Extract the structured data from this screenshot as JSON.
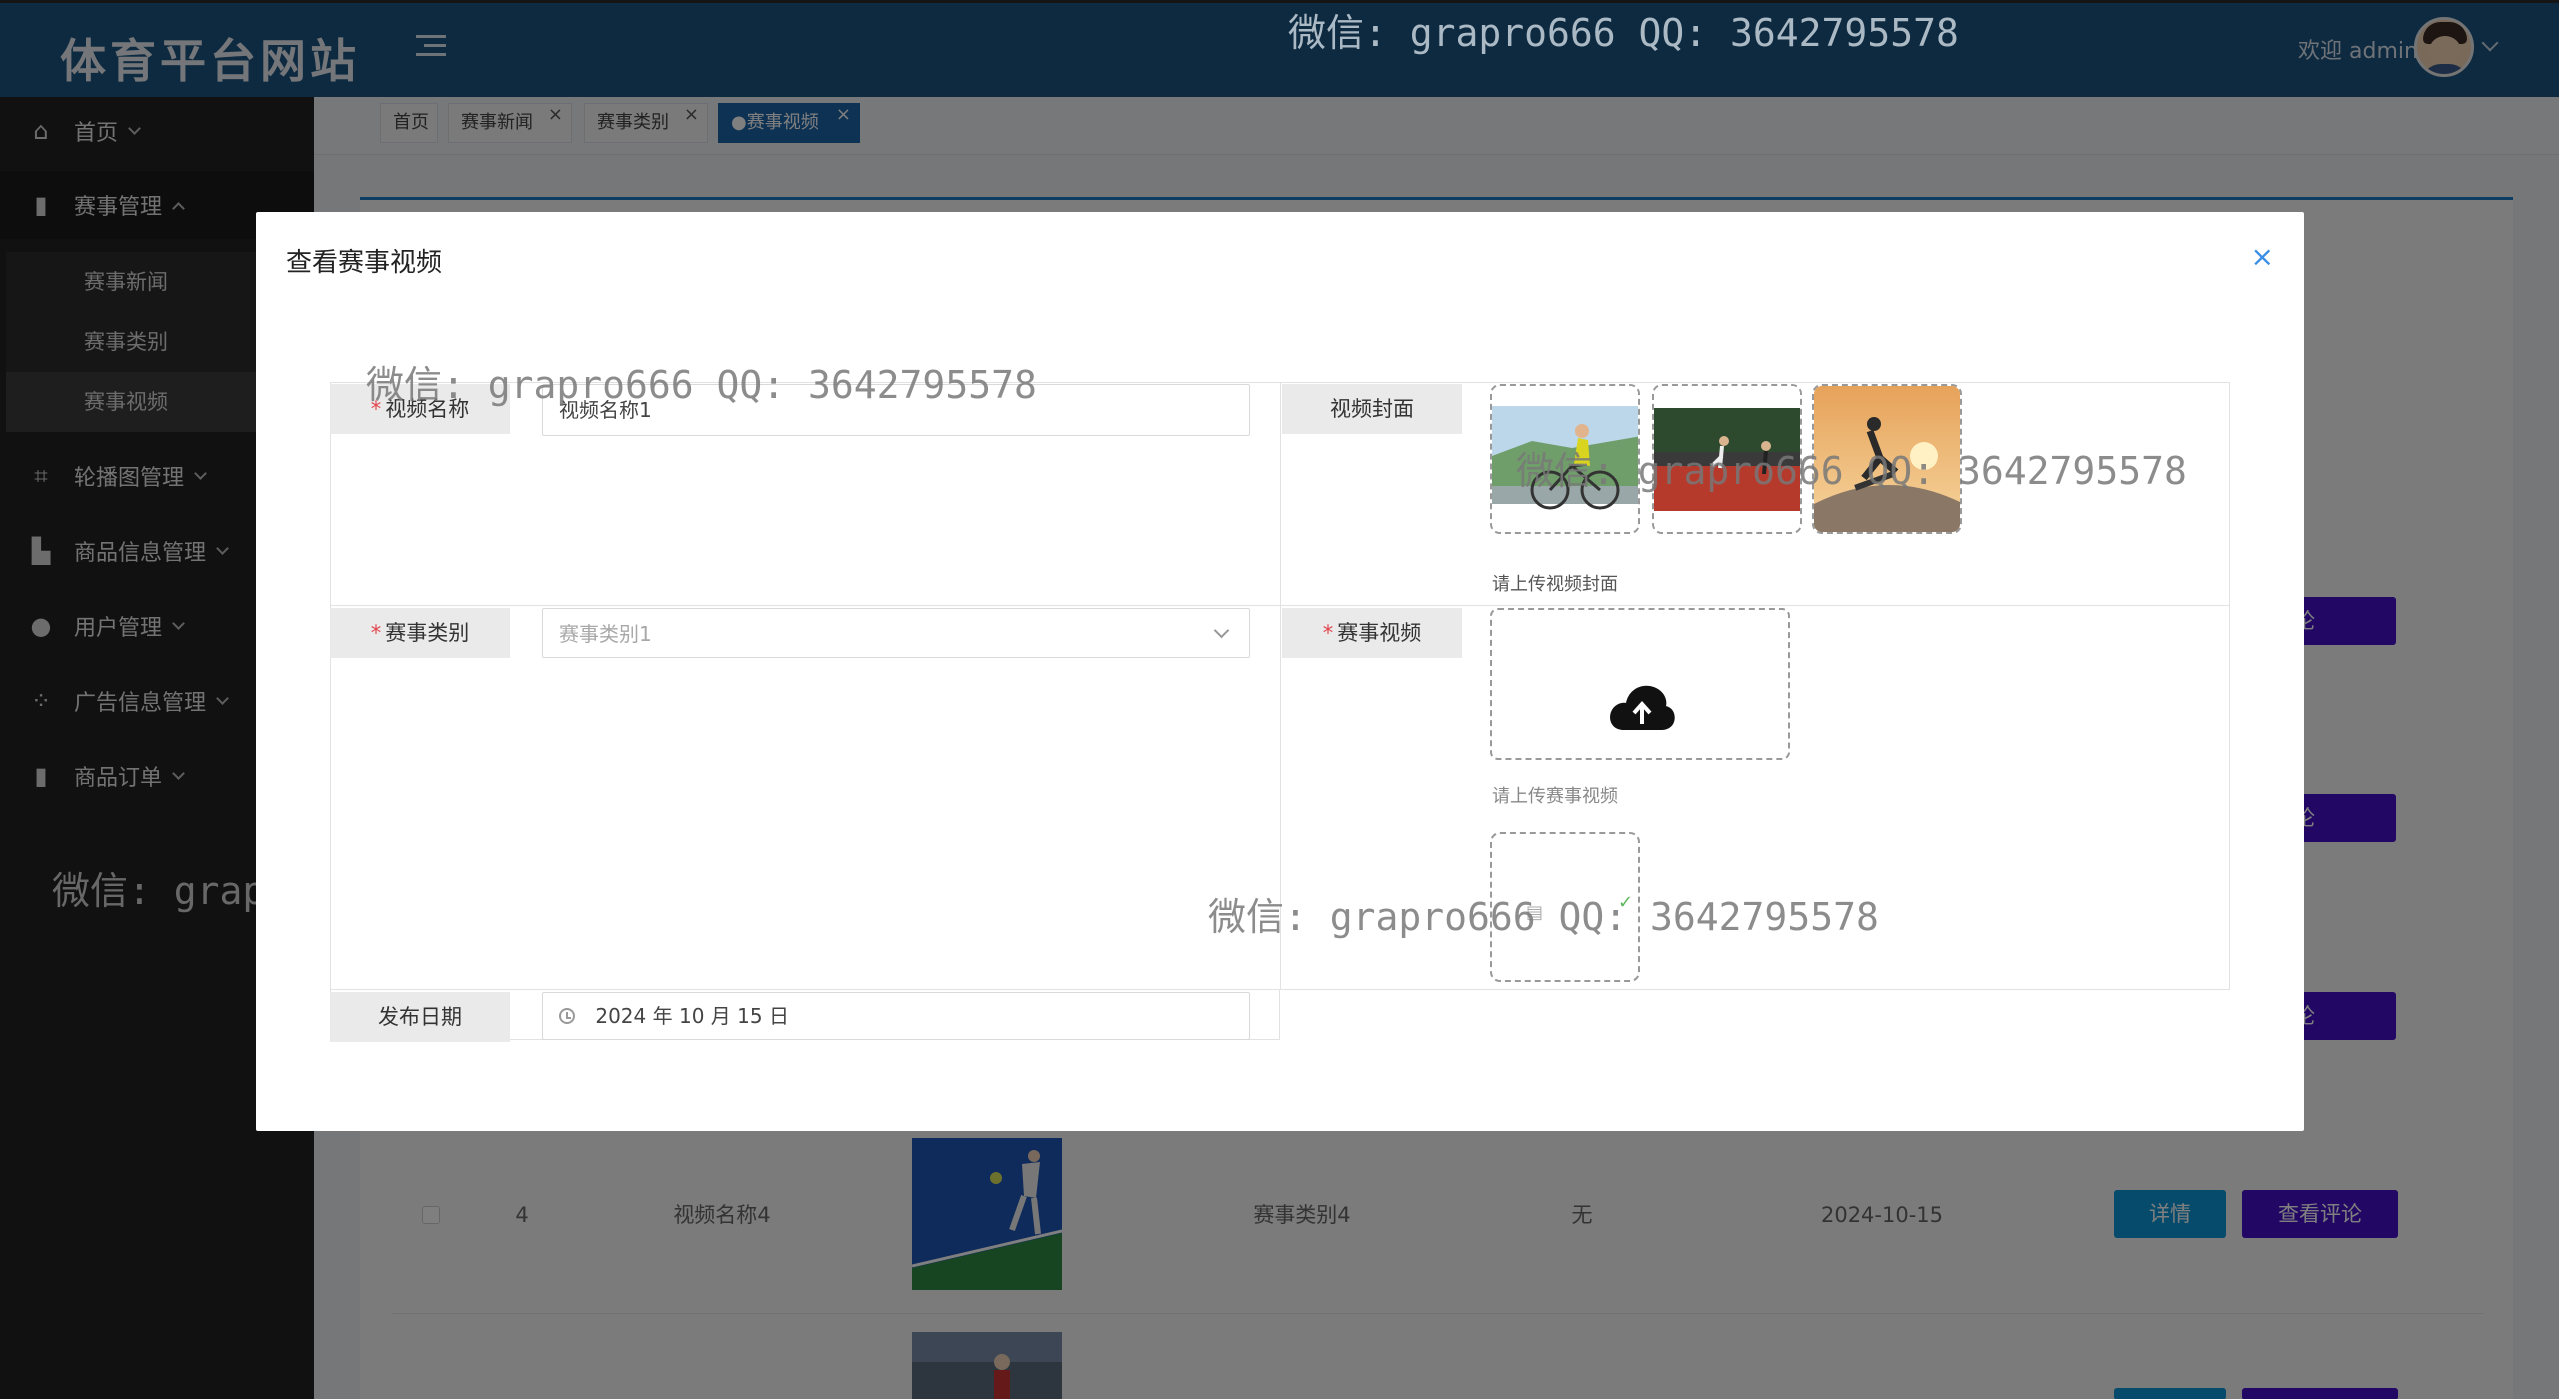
{
  "header": {
    "logo": "体育平台网站",
    "welcome": "欢迎 admin",
    "watermark": "微信: grapro666 QQ: 3642795578"
  },
  "sidebar": {
    "items": [
      {
        "label": "首页",
        "icon": "home-icon"
      },
      {
        "label": "赛事管理",
        "icon": "book-icon"
      },
      {
        "label": "轮播图管理",
        "icon": "crop-icon"
      },
      {
        "label": "商品信息管理",
        "icon": "chart-icon"
      },
      {
        "label": "用户管理",
        "icon": "user-icon"
      },
      {
        "label": "广告信息管理",
        "icon": "grid-icon"
      },
      {
        "label": "商品订单",
        "icon": "book-icon"
      }
    ],
    "submenu": [
      "赛事新闻",
      "赛事类别",
      "赛事视频"
    ]
  },
  "tabs": [
    {
      "label": "首页"
    },
    {
      "label": "赛事新闻"
    },
    {
      "label": "赛事类别"
    },
    {
      "label": "●赛事视频"
    }
  ],
  "table": {
    "row": {
      "index": "4",
      "name": "视频名称4",
      "category": "赛事类别4",
      "note": "无",
      "date": "2024-10-15"
    },
    "detail_label": "详情",
    "comment_label": "查看评论",
    "comment_label_partial": "看评论"
  },
  "modal": {
    "title": "查看赛事视频",
    "close": "×",
    "fields": {
      "name_label": "视频名称",
      "name_value": "视频名称1",
      "cover_label": "视频封面",
      "cover_hint": "请上传视频封面",
      "category_label": "赛事类别",
      "category_value": "赛事类别1",
      "video_label": "赛事视频",
      "video_hint": "请上传赛事视频",
      "date_label": "发布日期",
      "date_value": "2024 年 10 月 15 日"
    }
  },
  "watermarks": [
    "微信: grapro666 QQ: 3642795578",
    "微信: grapro666 QQ: 3642795578",
    "微信: grapro666 QQ: 3642795578",
    "微信: grapro666 QQ: 3642795578",
    "微信: grapro666 QQ: 3642795578"
  ]
}
